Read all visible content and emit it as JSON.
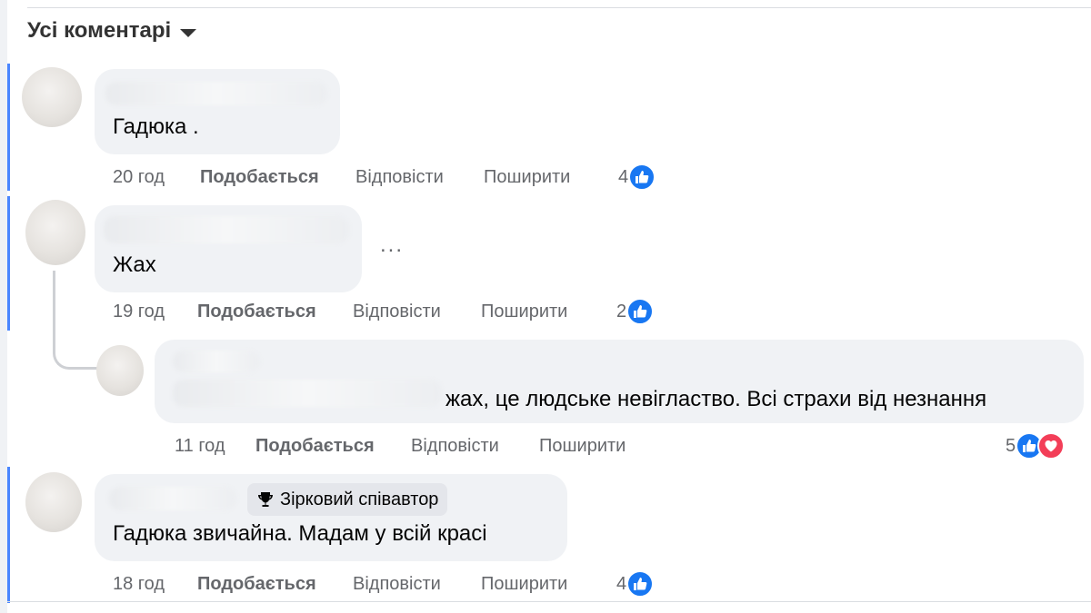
{
  "filter": {
    "label": "Усі коментарі"
  },
  "actions": {
    "like": "Подобається",
    "reply": "Відповісти",
    "share": "Поширити"
  },
  "comments": [
    {
      "text": "Гадюка .",
      "time": "20 год",
      "reactions": "4"
    },
    {
      "text": "Жах",
      "time": "19 год",
      "reactions": "2",
      "more": "..."
    },
    {
      "text": "жах, це людське невігластво. Всі страхи від незнання",
      "time": "11 год",
      "reactions": "5"
    },
    {
      "text": "Гадюка звичайна. Мадам у всій красі",
      "time": "18 год",
      "reactions": "4",
      "badge": "Зірковий співавтор"
    }
  ],
  "colors": {
    "accent": "#1877f2",
    "love": "#f33e58",
    "bubble": "#f0f2f5",
    "meta": "#65676b",
    "thread_bar": "#4a86ff"
  },
  "icons": {
    "like": "thumbs-up-icon",
    "love": "heart-icon",
    "badge": "trophy-icon",
    "filter": "caret-down-icon"
  }
}
